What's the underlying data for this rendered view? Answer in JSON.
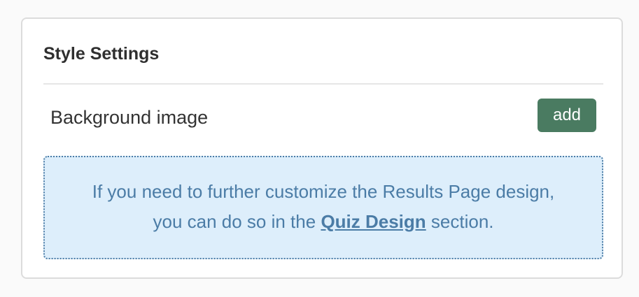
{
  "panel": {
    "title": "Style Settings"
  },
  "background_setting": {
    "label": "Background image",
    "add_label": "add"
  },
  "info": {
    "line1": "If you need to further customize the Results Page design,",
    "line2_prefix": "you can do so in the ",
    "link_text": "Quiz Design",
    "line2_suffix": " section."
  },
  "colors": {
    "accent_button": "#4a7b61",
    "info_background": "#ddeefb",
    "info_text": "#4b7ca6"
  }
}
